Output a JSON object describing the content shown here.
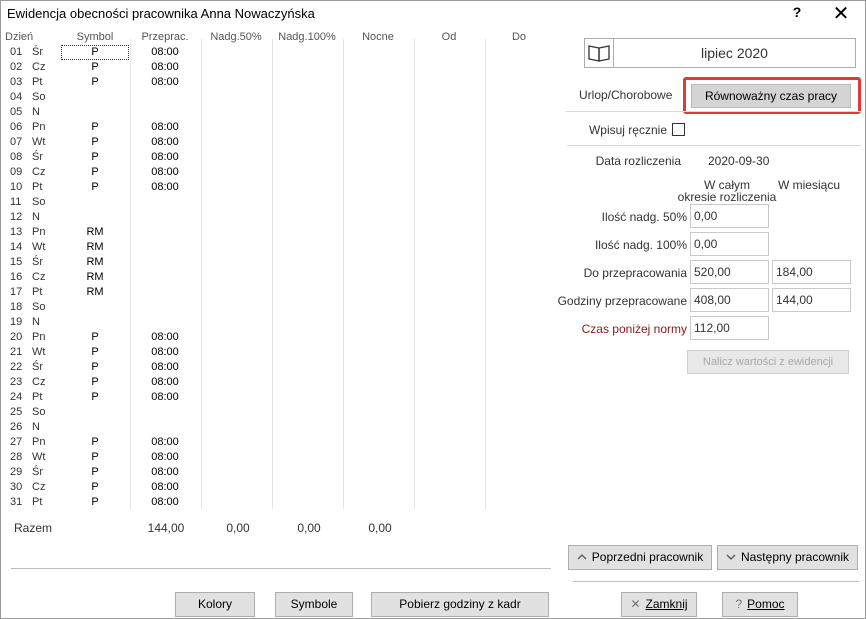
{
  "window": {
    "title": "Ewidencja obecności pracownika Anna Nowaczyńska",
    "help": "?",
    "close": "✕"
  },
  "grid": {
    "headers": {
      "day": "Dzień",
      "symbol": "Symbol",
      "przeprac": "Przeprac.",
      "nadg50": "Nadg.50%",
      "nadg100": "Nadg.100%",
      "nocne": "Nocne",
      "od": "Od",
      "do": "Do"
    },
    "rows": [
      {
        "day": "01",
        "dow": "Śr",
        "symbol": "P",
        "hours": "08:00"
      },
      {
        "day": "02",
        "dow": "Cz",
        "symbol": "P",
        "hours": "08:00"
      },
      {
        "day": "03",
        "dow": "Pt",
        "symbol": "P",
        "hours": "08:00"
      },
      {
        "day": "04",
        "dow": "So",
        "symbol": "",
        "hours": ""
      },
      {
        "day": "05",
        "dow": "N",
        "symbol": "",
        "hours": ""
      },
      {
        "day": "06",
        "dow": "Pn",
        "symbol": "P",
        "hours": "08:00"
      },
      {
        "day": "07",
        "dow": "Wt",
        "symbol": "P",
        "hours": "08:00"
      },
      {
        "day": "08",
        "dow": "Śr",
        "symbol": "P",
        "hours": "08:00"
      },
      {
        "day": "09",
        "dow": "Cz",
        "symbol": "P",
        "hours": "08:00"
      },
      {
        "day": "10",
        "dow": "Pt",
        "symbol": "P",
        "hours": "08:00"
      },
      {
        "day": "11",
        "dow": "So",
        "symbol": "",
        "hours": ""
      },
      {
        "day": "12",
        "dow": "N",
        "symbol": "",
        "hours": ""
      },
      {
        "day": "13",
        "dow": "Pn",
        "symbol": "RM",
        "hours": ""
      },
      {
        "day": "14",
        "dow": "Wt",
        "symbol": "RM",
        "hours": ""
      },
      {
        "day": "15",
        "dow": "Śr",
        "symbol": "RM",
        "hours": ""
      },
      {
        "day": "16",
        "dow": "Cz",
        "symbol": "RM",
        "hours": ""
      },
      {
        "day": "17",
        "dow": "Pt",
        "symbol": "RM",
        "hours": ""
      },
      {
        "day": "18",
        "dow": "So",
        "symbol": "",
        "hours": ""
      },
      {
        "day": "19",
        "dow": "N",
        "symbol": "",
        "hours": ""
      },
      {
        "day": "20",
        "dow": "Pn",
        "symbol": "P",
        "hours": "08:00"
      },
      {
        "day": "21",
        "dow": "Wt",
        "symbol": "P",
        "hours": "08:00"
      },
      {
        "day": "22",
        "dow": "Śr",
        "symbol": "P",
        "hours": "08:00"
      },
      {
        "day": "23",
        "dow": "Cz",
        "symbol": "P",
        "hours": "08:00"
      },
      {
        "day": "24",
        "dow": "Pt",
        "symbol": "P",
        "hours": "08:00"
      },
      {
        "day": "25",
        "dow": "So",
        "symbol": "",
        "hours": ""
      },
      {
        "day": "26",
        "dow": "N",
        "symbol": "",
        "hours": ""
      },
      {
        "day": "27",
        "dow": "Pn",
        "symbol": "P",
        "hours": "08:00"
      },
      {
        "day": "28",
        "dow": "Wt",
        "symbol": "P",
        "hours": "08:00"
      },
      {
        "day": "29",
        "dow": "Śr",
        "symbol": "P",
        "hours": "08:00"
      },
      {
        "day": "30",
        "dow": "Cz",
        "symbol": "P",
        "hours": "08:00"
      },
      {
        "day": "31",
        "dow": "Pt",
        "symbol": "P",
        "hours": "08:00"
      }
    ],
    "totals": {
      "label": "Razem",
      "przeprac": "144,00",
      "nadg50": "0,00",
      "nadg100": "0,00",
      "nocne": "0,00"
    }
  },
  "buttons": {
    "kolory": "Kolory",
    "symbole": "Symbole",
    "pobierz": "Pobierz godziny z kadr",
    "poprzedni": "Poprzedni pracownik",
    "nastepny": "Następny pracownik",
    "zamknij": "Zamknij",
    "pomoc": "Pomoc",
    "nalicz": "Nalicz wartości z ewidencji"
  },
  "month": {
    "label": "lipiec 2020",
    "icon": "book-icon"
  },
  "tabs": {
    "urlop": "Urlop/Chorobowe",
    "rownowazny": "Równoważny czas pracy"
  },
  "panel": {
    "wpisuj_label": "Wpisuj ręcznie",
    "wpisuj_checked": false,
    "data_rozliczenia_label": "Data rozliczenia",
    "data_rozliczenia": "2020-09-30",
    "col_caly_1": "W całym",
    "col_caly_2": "okresie rozliczenia",
    "col_miesiac": "W miesiącu",
    "nadg50_label": "Ilość nadg. 50%",
    "nadg50_value": "0,00",
    "nadg100_label": "Ilość nadg. 100%",
    "nadg100_value": "0,00",
    "do_przeprac_label": "Do przepracowania",
    "do_przeprac_caly": "520,00",
    "do_przeprac_miesiac": "184,00",
    "godz_przeprac_label": "Godziny przepracowane",
    "godz_przeprac_caly": "408,00",
    "godz_przeprac_miesiac": "144,00",
    "ponizej_label": "Czas poniżej normy",
    "ponizej_value": "112,00"
  },
  "colors": {
    "highlight": "#e0393a",
    "below_norm_label": "#8b1a1a"
  }
}
